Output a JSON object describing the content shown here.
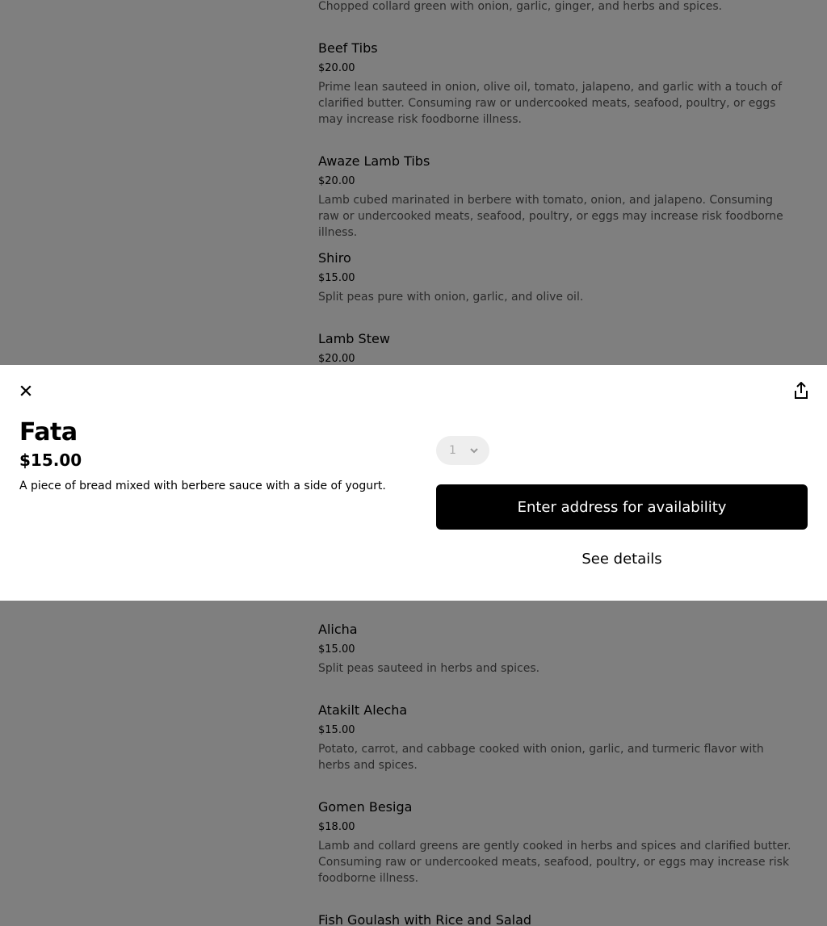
{
  "background_menu": {
    "items": [
      {
        "name": "",
        "price": "",
        "description": "Chopped collard green with onion, garlic, ginger, and herbs and spices."
      },
      {
        "name": "Beef Tibs",
        "price": "$20.00",
        "description": "Prime lean sauteed in onion, olive oil, tomato, jalapeno, and garlic with a touch of clarified butter. Consuming raw or undercooked meats, seafood, poultry, or eggs may increase risk foodborne illness."
      },
      {
        "name": "Awaze Lamb Tibs",
        "price": "$20.00",
        "description": "Lamb cubed marinated in berbere with tomato, onion, and jalapeno. Consuming raw or undercooked meats, seafood, poultry, or eggs may increase risk foodborne illness."
      },
      {
        "name": "Shiro",
        "price": "$15.00",
        "description": "Split peas pure with onion, garlic, and olive oil."
      },
      {
        "name": "Lamb Stew",
        "price": "$20.00",
        "description": ""
      },
      {
        "name": "Alicha",
        "price": "$15.00",
        "description": "Split peas sauteed in herbs and spices."
      },
      {
        "name": "Atakilt Alecha",
        "price": "$15.00",
        "description": "Potato, carrot, and cabbage cooked with onion, garlic, and turmeric flavor with herbs and spices."
      },
      {
        "name": "Gomen Besiga",
        "price": "$18.00",
        "description": "Lamb and collard greens are gently cooked in herbs and spices and clarified butter. Consuming raw or undercooked meats, seafood, poultry, or eggs may increase risk foodborne illness."
      },
      {
        "name": "Fish Goulash with Rice and Salad",
        "price": "",
        "description": ""
      }
    ]
  },
  "modal": {
    "title": "Fata",
    "price": "$15.00",
    "description": "A piece of bread mixed with berbere sauce with a side of yogurt.",
    "quantity": "1",
    "cta_label": "Enter address for availability",
    "details_label": "See details"
  },
  "icons": {
    "close": "close-icon",
    "share": "share-icon",
    "chevron": "chevron-down-icon"
  },
  "colors": {
    "overlay": "rgba(0,0,0,0.5)",
    "cta_bg": "#000000",
    "cta_text": "#ffffff",
    "qty_bg": "#eeeeee"
  }
}
